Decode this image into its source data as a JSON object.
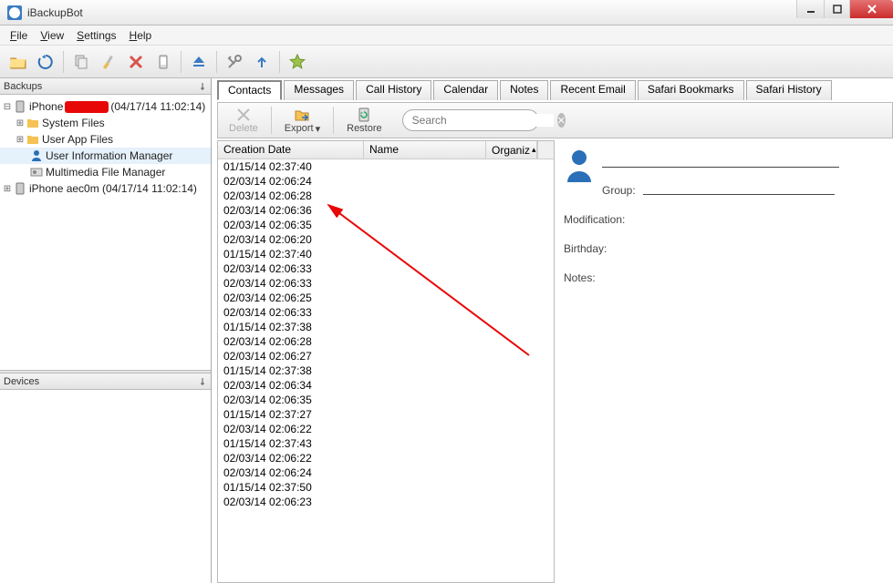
{
  "window": {
    "title": "iBackupBot"
  },
  "menu": {
    "file": "File",
    "view": "View",
    "settings": "Settings",
    "help": "Help"
  },
  "panels": {
    "backups": "Backups",
    "devices": "Devices"
  },
  "tree": {
    "device1_prefix": "iPhone ",
    "device1_suffix": "(04/17/14 11:02:14)",
    "system_files": "System Files",
    "user_app_files": "User App Files",
    "user_info_mgr": "User Information Manager",
    "mm_mgr": "Multimedia File Manager",
    "device2": "iPhone aec0m (04/17/14 11:02:14)"
  },
  "tabs": {
    "contacts": "Contacts",
    "messages": "Messages",
    "call_history": "Call History",
    "calendar": "Calendar",
    "notes": "Notes",
    "recent_email": "Recent Email",
    "safari_bookmarks": "Safari Bookmarks",
    "safari_history": "Safari History"
  },
  "actions": {
    "delete": "Delete",
    "export": "Export",
    "restore": "Restore"
  },
  "search": {
    "placeholder": "Search"
  },
  "columns": {
    "date": "Creation Date",
    "name": "Name",
    "org": "Organiz"
  },
  "rows": [
    "01/15/14 02:37:40",
    "02/03/14 02:06:24",
    "02/03/14 02:06:28",
    "02/03/14 02:06:36",
    "02/03/14 02:06:35",
    "02/03/14 02:06:20",
    "01/15/14 02:37:40",
    "02/03/14 02:06:33",
    "02/03/14 02:06:33",
    "02/03/14 02:06:25",
    "02/03/14 02:06:33",
    "01/15/14 02:37:38",
    "02/03/14 02:06:28",
    "02/03/14 02:06:27",
    "01/15/14 02:37:38",
    "02/03/14 02:06:34",
    "02/03/14 02:06:35",
    "01/15/14 02:37:27",
    "02/03/14 02:06:22",
    "01/15/14 02:37:43",
    "02/03/14 02:06:22",
    "02/03/14 02:06:24",
    "01/15/14 02:37:50",
    "02/03/14 02:06:23"
  ],
  "detail": {
    "group": "Group:",
    "modification": "Modification:",
    "birthday": "Birthday:",
    "notes": "Notes:"
  }
}
